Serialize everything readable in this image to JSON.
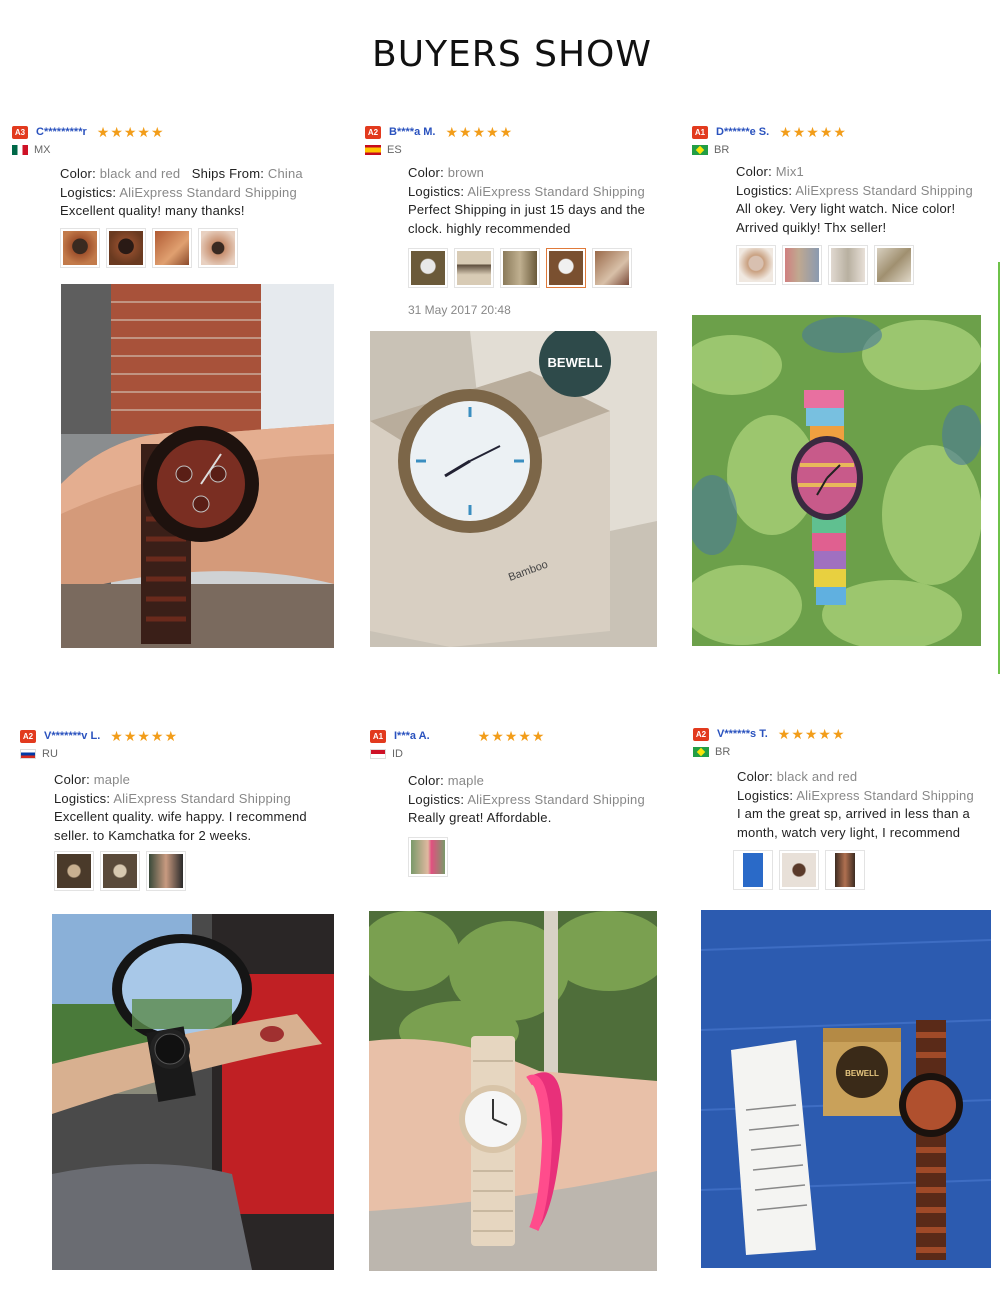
{
  "page": {
    "title": "BUYERS SHOW"
  },
  "reviews": [
    {
      "badge": "A3",
      "user": "C*********r",
      "stars": "★★★★★",
      "country": "MX",
      "color_label": "Color:",
      "color": "black and red",
      "ships_label": "Ships From:",
      "ships": "China",
      "logistics_label": "Logistics:",
      "logistics": "AliExpress Standard Shipping",
      "text": "Excellent quality! many thanks!",
      "thumb_colors": [
        "#a0522d",
        "#8b4a2b",
        "#b05a33",
        "#c89070"
      ],
      "photo_desc": "wrist with black and red wooden chronograph watch"
    },
    {
      "badge": "A2",
      "user": "B****a M.",
      "stars": "★★★★★",
      "country": "ES",
      "color_label": "Color:",
      "color": "brown",
      "logistics_label": "Logistics:",
      "logistics": "AliExpress Standard Shipping",
      "text1": "Perfect Shipping in just 15 days and the",
      "text2": "clock. highly recommended",
      "date": "31 May 2017 20:48",
      "thumb_colors": [
        "#6b5a3a",
        "#d8cbb5",
        "#8a7a5a",
        "#7a5030",
        "#9a6a4a"
      ],
      "brand": "BEWELL",
      "box_label": "Bamboo",
      "photo_desc": "bamboo watch in open cardboard box"
    },
    {
      "badge": "A1",
      "user": "D******e S.",
      "stars": "★★★★★",
      "country": "BR",
      "color_label": "Color:",
      "color": "Mix1",
      "logistics_label": "Logistics:",
      "logistics": "AliExpress Standard Shipping",
      "text1": "All okey. Very light watch. Nice color!",
      "text2": "Arrived quikly! Thx seller!",
      "thumb_colors": [
        "#c9a080",
        "#c0a890",
        "#b8b0a0",
        "#a09070"
      ],
      "photo_desc": "multicolor wooden watch on green leafy fabric"
    },
    {
      "badge": "A2",
      "user": "V*******v L.",
      "stars": "★★★★★",
      "country": "RU",
      "color_label": "Color:",
      "color": "maple",
      "logistics_label": "Logistics:",
      "logistics": "AliExpress Standard Shipping",
      "text1": "Excellent quality. wife happy. I recommend",
      "text2": "seller. to Kamchatka for 2 weeks.",
      "thumb_colors": [
        "#4a3a2a",
        "#5a4a3a",
        "#3a4a3a"
      ],
      "photo_desc": "wrist with black watch in car by side mirror"
    },
    {
      "badge": "A1",
      "user": "I***a A.",
      "stars": "★★★★★",
      "country": "ID",
      "color_label": "Color:",
      "color": "maple",
      "logistics_label": "Logistics:",
      "logistics": "AliExpress Standard Shipping",
      "text": "Really great! Affordable.",
      "thumb_colors": [
        "#7a9a6a"
      ],
      "photo_desc": "wrist with maple wooden watch and pink hair band"
    },
    {
      "badge": "A2",
      "user": "V******s T.",
      "stars": "★★★★★",
      "country": "BR",
      "color_label": "Color:",
      "color": "black and red",
      "logistics_label": "Logistics:",
      "logistics": "AliExpress Standard Shipping",
      "text1": "I am the great sp, arrived in less than a",
      "text2": "month, watch very light, I recommend",
      "thumb_colors": [
        "#2a6ac8",
        "#b08060",
        "#3a2a20"
      ],
      "brand": "BEWELL",
      "photo_desc": "watch with box and manual on blue surface"
    }
  ]
}
